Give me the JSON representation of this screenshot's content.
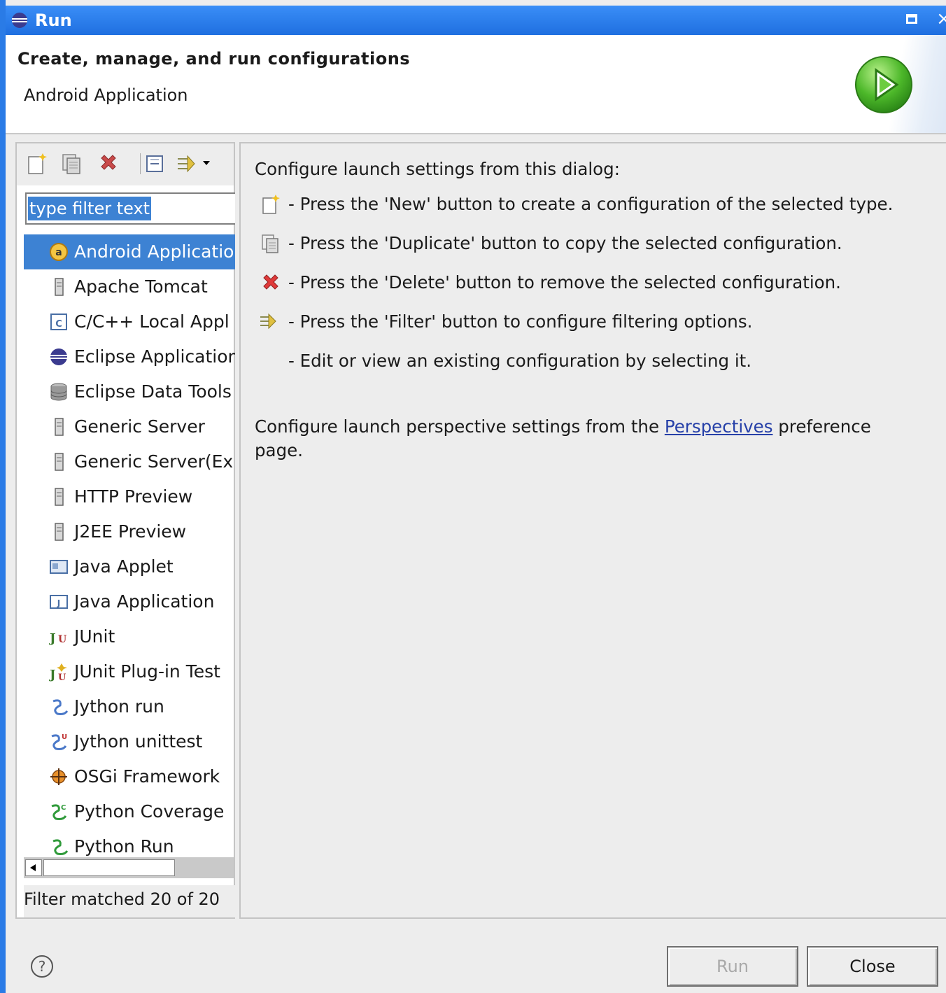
{
  "window": {
    "title": "Run"
  },
  "header": {
    "title": "Create, manage, and run configurations",
    "subtitle": "Android Application"
  },
  "toolbar": {
    "buttons": [
      "new-config-icon",
      "duplicate-icon",
      "delete-icon",
      "collapse-all-icon",
      "filter-icon"
    ]
  },
  "filter": {
    "value": "type filter text"
  },
  "tree": {
    "items": [
      {
        "label": "Android Applicatio",
        "icon": "android-icon",
        "selected": true
      },
      {
        "label": "Apache Tomcat",
        "icon": "server-icon"
      },
      {
        "label": "C/C++ Local Appl",
        "icon": "cpp-app-icon"
      },
      {
        "label": "Eclipse Application",
        "icon": "eclipse-icon"
      },
      {
        "label": "Eclipse Data Tools",
        "icon": "database-icon"
      },
      {
        "label": "Generic Server",
        "icon": "server-icon"
      },
      {
        "label": "Generic Server(Ex",
        "icon": "server-icon"
      },
      {
        "label": "HTTP Preview",
        "icon": "server-icon"
      },
      {
        "label": "J2EE Preview",
        "icon": "server-icon"
      },
      {
        "label": "Java Applet",
        "icon": "applet-icon"
      },
      {
        "label": "Java Application",
        "icon": "java-app-icon"
      },
      {
        "label": "JUnit",
        "icon": "junit-icon"
      },
      {
        "label": "JUnit Plug-in Test",
        "icon": "junit-plugin-icon"
      },
      {
        "label": "Jython run",
        "icon": "jython-icon"
      },
      {
        "label": "Jython unittest",
        "icon": "jython-unittest-icon"
      },
      {
        "label": "OSGi Framework",
        "icon": "osgi-icon"
      },
      {
        "label": "Python Coverage",
        "icon": "python-coverage-icon"
      },
      {
        "label": "Python Run",
        "icon": "python-icon"
      }
    ],
    "status": "Filter matched 20 of 20"
  },
  "main": {
    "intro": "Configure launch settings from this dialog:",
    "lines": [
      {
        "icon": "new-config-icon",
        "text": "- Press the 'New' button to create a configuration of the selected type."
      },
      {
        "icon": "duplicate-icon",
        "text": "- Press the 'Duplicate' button to copy the selected configuration."
      },
      {
        "icon": "delete-icon",
        "text": "- Press the 'Delete' button to remove the selected configuration."
      },
      {
        "icon": "filter-icon",
        "text": "- Press the 'Filter' button to configure filtering options."
      },
      {
        "icon": "",
        "text": "- Edit or view an existing configuration by selecting it."
      }
    ],
    "perspective_before": "Configure launch perspective settings from the ",
    "perspective_link": "Perspectives",
    "perspective_after": " preference",
    "perspective_line2": "page."
  },
  "buttons": {
    "run_label": "Run",
    "close_label": "Close"
  }
}
